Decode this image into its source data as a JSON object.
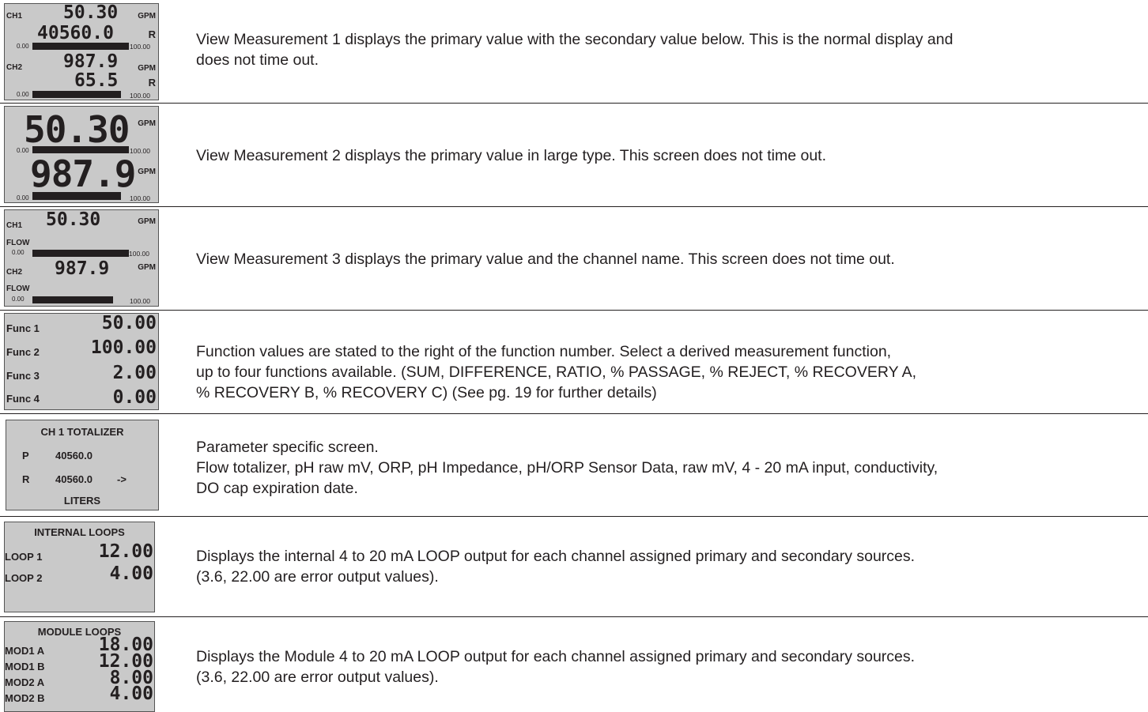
{
  "rows": [
    {
      "screen": {
        "ch1_label": "CH1",
        "ch1_primary": "50.30",
        "ch1_unit": "GPM",
        "ch1_secondary": "40560.0",
        "ch1_sec_unit": "R",
        "bar1_min": "0.00",
        "bar1_max": "100.00",
        "ch2_label": "CH2",
        "ch2_primary": "987.9",
        "ch2_unit": "GPM",
        "ch2_secondary": "65.5",
        "ch2_sec_unit": "R",
        "bar2_min": "0.00",
        "bar2_max": "100.00"
      },
      "description": [
        "View Measurement 1 displays the primary value with the secondary value below.  This is the normal display and",
        "does not time out."
      ]
    },
    {
      "screen": {
        "v1": "50.30",
        "u1": "GPM",
        "bar1_min": "0.00",
        "bar1_max": "100.00",
        "v2": "987.9",
        "u2": "GPM",
        "bar2_min": "0.00",
        "bar2_max": "100.00"
      },
      "description": [
        "View Measurement 2 displays the primary value in large type.  This screen does not time out."
      ]
    },
    {
      "screen": {
        "ch1_label": "CH1",
        "ch1_value": "50.30",
        "ch1_unit": "GPM",
        "ch1_name": "FLOW",
        "bar1_min": "0.00",
        "bar1_max": "100.00",
        "ch2_label": "CH2",
        "ch2_value": "987.9",
        "ch2_unit": "GPM",
        "ch2_name": "FLOW",
        "bar2_min": "0.00",
        "bar2_max": "100.00"
      },
      "description": [
        "View Measurement 3 displays the primary value and the channel name.  This screen does not time out."
      ]
    },
    {
      "screen": {
        "functions": [
          {
            "label": "Func 1",
            "value": "50.00"
          },
          {
            "label": "Func 2",
            "value": "100.00"
          },
          {
            "label": "Func 3",
            "value": "2.00"
          },
          {
            "label": "Func 4",
            "value": "0.00"
          }
        ]
      },
      "description": [
        "Function values are stated to the right of the function number.  Select a derived measurement function,",
        "up to four functions available. (SUM, DIFFERENCE, RATIO, % PASSAGE, % REJECT, % RECOVERY A,",
        "% RECOVERY B, % RECOVERY C) (See pg. 19 for further details)"
      ]
    },
    {
      "screen": {
        "title": "CH 1 TOTALIZER",
        "p_label": "P",
        "p_value": "40560.0",
        "r_label": "R",
        "r_value": "40560.0",
        "arrow": "->",
        "units": "LITERS"
      },
      "description": [
        "Parameter specific screen.",
        "Flow totalizer, pH raw mV, ORP, pH Impedance, pH/ORP Sensor Data, raw mV, 4 - 20 mA input, conductivity,",
        "DO cap expiration date."
      ]
    },
    {
      "screen": {
        "title": "INTERNAL LOOPS",
        "loops": [
          {
            "label": "LOOP 1",
            "value": "12.00"
          },
          {
            "label": "LOOP 2",
            "value": "4.00"
          }
        ]
      },
      "description": [
        "Displays the internal 4 to 20 mA LOOP output for each channel assigned primary and secondary sources.",
        "(3.6, 22.00 are error output values)."
      ]
    },
    {
      "screen": {
        "title": "MODULE LOOPS",
        "loops": [
          {
            "label": "MOD1 A",
            "value": "18.00"
          },
          {
            "label": "MOD1 B",
            "value": "12.00"
          },
          {
            "label": "MOD2 A",
            "value": "8.00"
          },
          {
            "label": "MOD2 B",
            "value": "4.00"
          }
        ]
      },
      "description": [
        "Displays the Module 4 to 20 mA LOOP output for each channel assigned primary and secondary sources.",
        "(3.6, 22.00 are error output values)."
      ]
    }
  ]
}
